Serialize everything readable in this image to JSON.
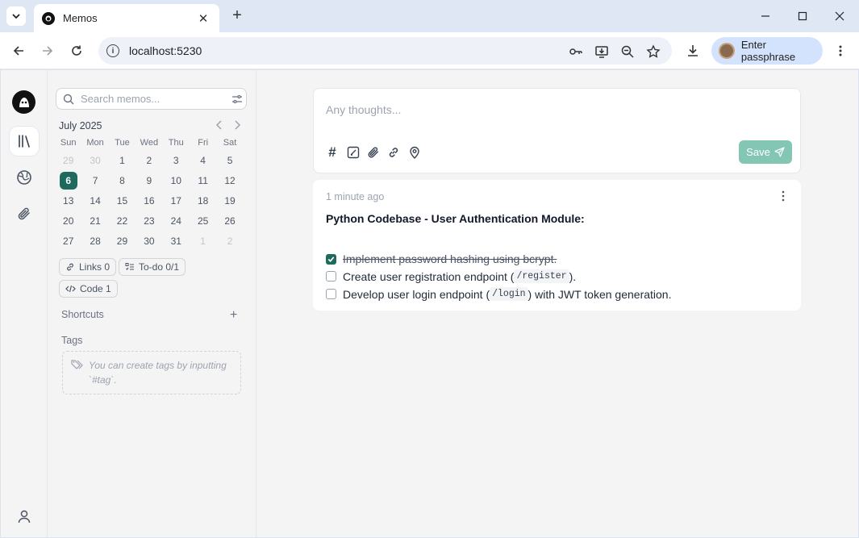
{
  "browser": {
    "tab_title": "Memos",
    "url": "localhost:5230",
    "profile_label": "Enter passphrase",
    "new_tab_symbol": "+",
    "close_tab_symbol": "✕"
  },
  "search": {
    "placeholder": "Search memos..."
  },
  "calendar": {
    "month_label": "July 2025",
    "weekdays": [
      "Sun",
      "Mon",
      "Tue",
      "Wed",
      "Thu",
      "Fri",
      "Sat"
    ],
    "weeks": [
      [
        "29",
        "30",
        "1",
        "2",
        "3",
        "4",
        "5"
      ],
      [
        "6",
        "7",
        "8",
        "9",
        "10",
        "11",
        "12"
      ],
      [
        "13",
        "14",
        "15",
        "16",
        "17",
        "18",
        "19"
      ],
      [
        "20",
        "21",
        "22",
        "23",
        "24",
        "25",
        "26"
      ],
      [
        "27",
        "28",
        "29",
        "30",
        "31",
        "1",
        "2"
      ]
    ],
    "today": "6"
  },
  "stats": {
    "links": "Links 0",
    "todo": "To-do 0/1",
    "code": "Code 1"
  },
  "shortcuts": {
    "title": "Shortcuts",
    "add_symbol": "+"
  },
  "tags": {
    "title": "Tags",
    "hint": "You can create tags by inputting `#tag`."
  },
  "editor": {
    "placeholder": "Any thoughts...",
    "save_label": "Save",
    "tag_symbol": "#"
  },
  "memo": {
    "time": "1 minute ago",
    "title": "Python Codebase - User Authentication Module:",
    "tasks": [
      {
        "checked": true,
        "text": "Implement password hashing using bcrypt."
      },
      {
        "checked": false,
        "before": "Create user registration endpoint (",
        "code": "/register",
        "after": ")."
      },
      {
        "checked": false,
        "before": "Develop user login endpoint (",
        "code": "/login",
        "after": ") with JWT token generation."
      }
    ]
  },
  "colors": {
    "accent": "#1e6b5d",
    "save_button": "#83c6b4"
  }
}
